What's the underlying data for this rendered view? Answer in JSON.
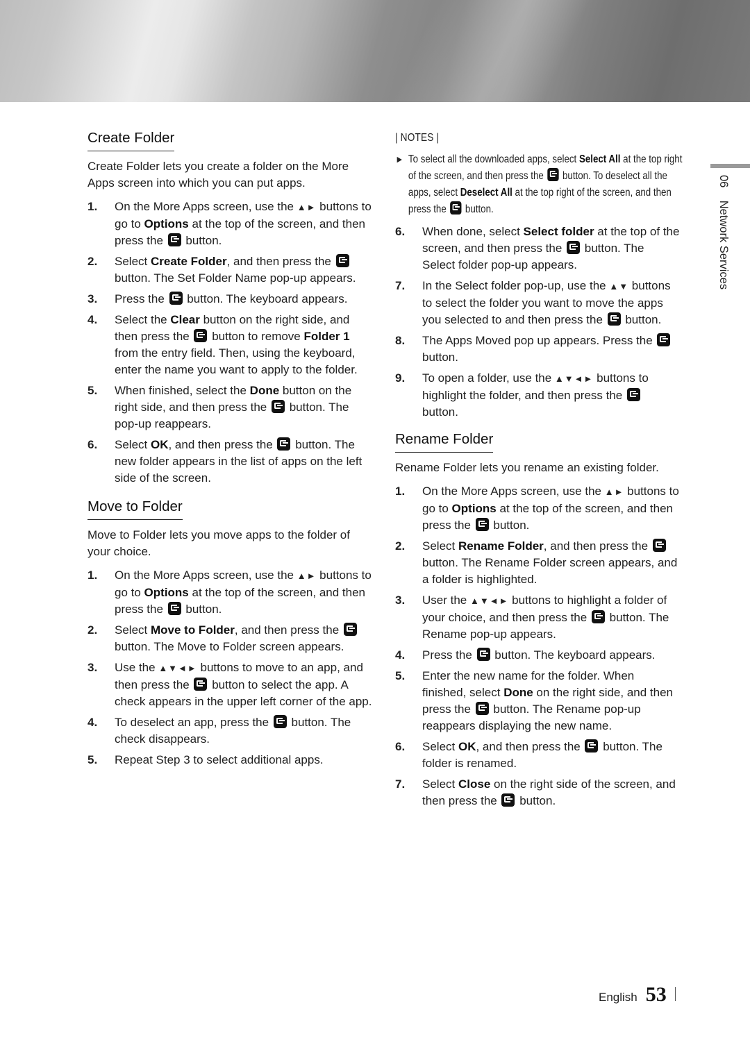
{
  "banner": {
    "description": "silver-gradient-header"
  },
  "side_label": {
    "chapter": "06",
    "title": "Network Services"
  },
  "footer": {
    "language": "English",
    "page_number": "53"
  },
  "left_column": {
    "create_folder": {
      "heading": "Create Folder",
      "intro": "Create Folder lets you create a folder on the More Apps screen into which you can put apps.",
      "steps": [
        {
          "n": "1.",
          "parts": [
            "On the More Apps screen, use the ",
            {
              "arrows": "▲►"
            },
            " buttons to go to ",
            {
              "b": "Options"
            },
            " at the top of the screen, and then press the ",
            {
              "icon": "enter"
            },
            " button."
          ]
        },
        {
          "n": "2.",
          "parts": [
            "Select ",
            {
              "b": "Create Folder"
            },
            ", and then press the ",
            {
              "icon": "enter"
            },
            " button. The Set Folder Name pop-up appears."
          ]
        },
        {
          "n": "3.",
          "parts": [
            "Press the ",
            {
              "icon": "enter"
            },
            " button. The keyboard appears."
          ]
        },
        {
          "n": "4.",
          "parts": [
            "Select the ",
            {
              "b": "Clear"
            },
            " button on the right side, and then press the ",
            {
              "icon": "enter"
            },
            " button to remove ",
            {
              "b": "Folder 1"
            },
            " from the entry field. Then, using the keyboard, enter the name you want to apply to the folder."
          ]
        },
        {
          "n": "5.",
          "parts": [
            "When finished, select the ",
            {
              "b": "Done"
            },
            " button on the right side, and then press the ",
            {
              "icon": "enter"
            },
            " button. The pop-up reappears."
          ]
        },
        {
          "n": "6.",
          "parts": [
            "Select ",
            {
              "b": "OK"
            },
            ", and then press the ",
            {
              "icon": "enter"
            },
            " button. The new folder appears in the list of apps on the left side of the screen."
          ]
        }
      ]
    },
    "move_to_folder": {
      "heading": "Move to Folder",
      "intro": "Move to Folder lets you move apps to the folder of your choice.",
      "steps": [
        {
          "n": "1.",
          "parts": [
            "On the More Apps screen, use the ",
            {
              "arrows": "▲►"
            },
            " buttons to go to ",
            {
              "b": "Options"
            },
            " at the top of the screen, and then press the ",
            {
              "icon": "enter"
            },
            " button."
          ]
        },
        {
          "n": "2.",
          "parts": [
            "Select ",
            {
              "b": "Move to Folder"
            },
            ", and then press the ",
            {
              "icon": "enter"
            },
            " button. The Move to Folder screen appears."
          ]
        },
        {
          "n": "3.",
          "parts": [
            "Use the ",
            {
              "arrows": "▲▼◄►"
            },
            " buttons to move to an app, and then press the ",
            {
              "icon": "enter"
            },
            " button to select the app. A check appears in the upper left corner of the app."
          ]
        },
        {
          "n": "4.",
          "parts": [
            "To deselect an app, press the ",
            {
              "icon": "enter"
            },
            " button. The check disappears."
          ]
        },
        {
          "n": "5.",
          "parts": [
            "Repeat Step 3 to select additional apps."
          ]
        }
      ]
    }
  },
  "right_column": {
    "notes": {
      "title": "| NOTES |",
      "items": [
        {
          "parts": [
            "To select all the downloaded apps, select ",
            {
              "b": "Select All"
            },
            " at the top right of the screen, and then press the ",
            {
              "icon": "enter"
            },
            " button. To deselect all the apps, select ",
            {
              "b": "Deselect All"
            },
            " at the top right of the screen, and then press the ",
            {
              "icon": "enter"
            },
            " button."
          ]
        }
      ]
    },
    "move_to_folder_cont": {
      "steps": [
        {
          "n": "6.",
          "parts": [
            "When done, select ",
            {
              "b": "Select folder"
            },
            " at the top of the screen, and then press the ",
            {
              "icon": "enter"
            },
            " button. The Select folder pop-up appears."
          ]
        },
        {
          "n": "7.",
          "parts": [
            "In the Select folder pop-up, use the ",
            {
              "arrows": "▲▼"
            },
            " buttons to select the folder you want to move the apps you selected to and then press the ",
            {
              "icon": "enter"
            },
            " button."
          ]
        },
        {
          "n": "8.",
          "parts": [
            "The Apps Moved pop up appears. Press the ",
            {
              "icon": "enter"
            },
            " button."
          ]
        },
        {
          "n": "9.",
          "parts": [
            "To open a folder, use the ",
            {
              "arrows": "▲▼◄►"
            },
            " buttons to highlight the folder, and then press the ",
            {
              "icon": "enter"
            },
            " button."
          ]
        }
      ]
    },
    "rename_folder": {
      "heading": "Rename Folder",
      "intro": "Rename Folder lets you rename an existing folder.",
      "steps": [
        {
          "n": "1.",
          "parts": [
            "On the More Apps screen, use the ",
            {
              "arrows": "▲►"
            },
            " buttons to go to ",
            {
              "b": "Options"
            },
            " at the top of the screen, and then press the ",
            {
              "icon": "enter"
            },
            " button."
          ]
        },
        {
          "n": "2.",
          "parts": [
            "Select ",
            {
              "b": "Rename Folder"
            },
            ", and then press the ",
            {
              "icon": "enter"
            },
            " button. The Rename Folder screen appears, and a folder is highlighted."
          ]
        },
        {
          "n": "3.",
          "parts": [
            "User the ",
            {
              "arrows": "▲▼◄►"
            },
            " buttons to highlight a folder of your choice, and then press the ",
            {
              "icon": "enter"
            },
            " button. The Rename pop-up appears."
          ]
        },
        {
          "n": "4.",
          "parts": [
            "Press the ",
            {
              "icon": "enter"
            },
            " button. The keyboard appears."
          ]
        },
        {
          "n": "5.",
          "parts": [
            "Enter the new name for the folder. When finished, select ",
            {
              "b": "Done"
            },
            " on the right side, and then press the ",
            {
              "icon": "enter"
            },
            " button. The Rename pop-up reappears displaying the new name."
          ]
        },
        {
          "n": "6.",
          "parts": [
            "Select ",
            {
              "b": "OK"
            },
            ", and then press the ",
            {
              "icon": "enter"
            },
            " button. The folder is renamed."
          ]
        },
        {
          "n": "7.",
          "parts": [
            "Select ",
            {
              "b": "Close"
            },
            " on the right side of the screen, and then press the ",
            {
              "icon": "enter"
            },
            " button."
          ]
        }
      ]
    }
  }
}
